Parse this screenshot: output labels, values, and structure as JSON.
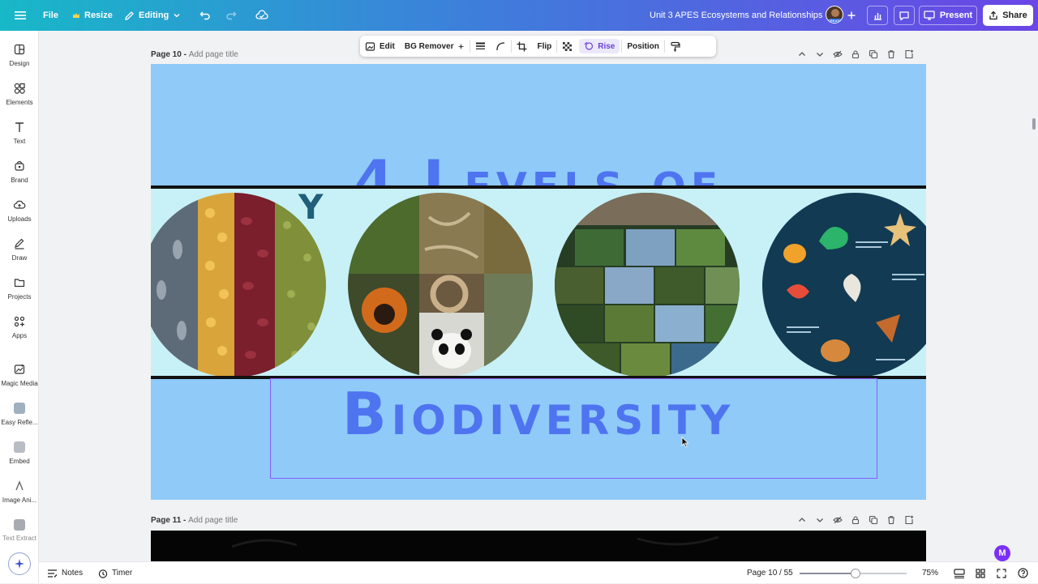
{
  "topbar": {
    "file_label": "File",
    "resize_label": "Resize",
    "editing_label": "Editing",
    "doc_title": "Unit 3 APES Ecosystems and Relationships",
    "avatar_badge": "CREATOR",
    "present_label": "Present",
    "share_label": "Share"
  },
  "sidebar": {
    "items": [
      {
        "label": "Design",
        "icon": "layout-icon"
      },
      {
        "label": "Elements",
        "icon": "shapes-icon"
      },
      {
        "label": "Text",
        "icon": "text-icon"
      },
      {
        "label": "Brand",
        "icon": "brand-icon"
      },
      {
        "label": "Uploads",
        "icon": "cloud-upload-icon"
      },
      {
        "label": "Draw",
        "icon": "pen-icon"
      },
      {
        "label": "Projects",
        "icon": "folder-icon"
      },
      {
        "label": "Apps",
        "icon": "apps-icon"
      },
      {
        "label": "Magic Media",
        "icon": "magic-media-icon"
      },
      {
        "label": "Easy Refle...",
        "icon": "app-icon"
      },
      {
        "label": "Embed",
        "icon": "embed-icon"
      },
      {
        "label": "Image Ani...",
        "icon": "image-animate-icon"
      },
      {
        "label": "Text Extract",
        "icon": "text-extract-icon"
      }
    ]
  },
  "context_toolbar": {
    "edit_label": "Edit",
    "bg_remover_label": "BG Remover",
    "flip_label": "Flip",
    "rise_label": "Rise",
    "position_label": "Position"
  },
  "page10": {
    "label": "Page 10 -",
    "title_placeholder": "Add page title",
    "slide": {
      "heading_top": "4 Levels of",
      "heading_bottom": "Biodiversity",
      "partial_letter": "Y"
    }
  },
  "page11": {
    "label": "Page 11 -",
    "title_placeholder": "Add page title"
  },
  "bottombar": {
    "notes_label": "Notes",
    "timer_label": "Timer",
    "page_indicator": "Page 10 / 55",
    "zoom_label": "75%",
    "zoom_fraction": 0.52,
    "m_badge": "M"
  },
  "colors": {
    "slide_bg": "#8fcaf9",
    "heading": "#4f74f0",
    "strip_bg": "#c7f1f6",
    "selection": "#8b5cf6",
    "topbar_start": "#18b8c8",
    "topbar_end": "#6b45e6"
  }
}
